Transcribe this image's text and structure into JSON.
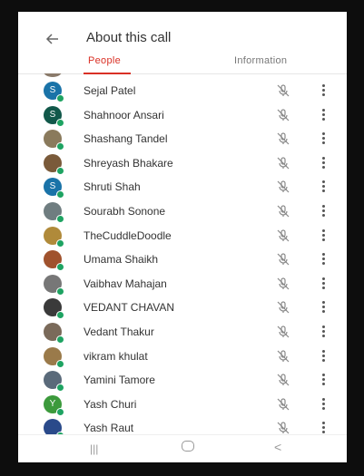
{
  "header": {
    "title": "About this call"
  },
  "tabs": [
    {
      "label": "People",
      "active": true
    },
    {
      "label": "Information",
      "active": false
    }
  ],
  "colors": {
    "accent": "#d93025",
    "presence": "#1ea362"
  },
  "participants": [
    {
      "name": "Sejal Patel",
      "initial": "S",
      "avatar_color": "#1a73a8"
    },
    {
      "name": "Shahnoor Ansari",
      "initial": "S",
      "avatar_color": "#11584a"
    },
    {
      "name": "Shashang Tandel",
      "initial": "",
      "avatar_color": "#8a7a5c"
    },
    {
      "name": "Shreyash Bhakare",
      "initial": "",
      "avatar_color": "#7a5a3a"
    },
    {
      "name": "Shruti Shah",
      "initial": "S",
      "avatar_color": "#1a73a8"
    },
    {
      "name": "Sourabh Sonone",
      "initial": "",
      "avatar_color": "#6f7d80"
    },
    {
      "name": "TheCuddleDoodle",
      "initial": "",
      "avatar_color": "#b08a3a"
    },
    {
      "name": "Umama Shaikh",
      "initial": "",
      "avatar_color": "#a0522d"
    },
    {
      "name": "Vaibhav Mahajan",
      "initial": "",
      "avatar_color": "#777777"
    },
    {
      "name": "VEDANT CHAVAN",
      "initial": "",
      "avatar_color": "#3a3a3a"
    },
    {
      "name": "Vedant Thakur",
      "initial": "",
      "avatar_color": "#7a6a5a"
    },
    {
      "name": "vikram khulat",
      "initial": "",
      "avatar_color": "#9a7a4a"
    },
    {
      "name": "Yamini Tamore",
      "initial": "",
      "avatar_color": "#5a6a7a"
    },
    {
      "name": "Yash Churi",
      "initial": "Y",
      "avatar_color": "#3c9a3c"
    },
    {
      "name": "Yash Raut",
      "initial": "",
      "avatar_color": "#2a4a8a"
    }
  ]
}
